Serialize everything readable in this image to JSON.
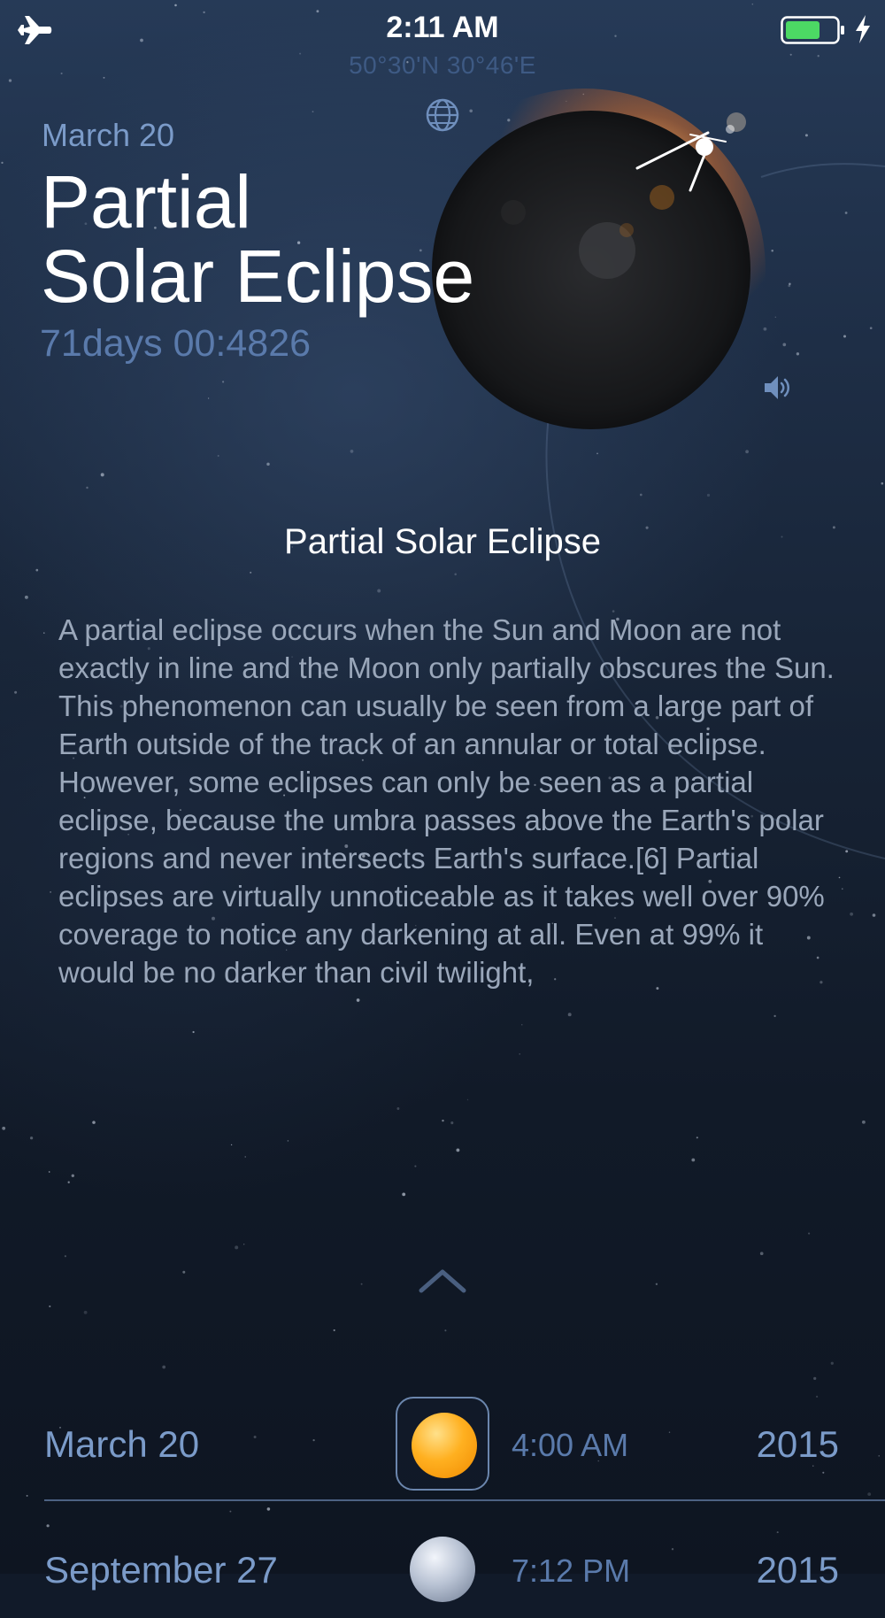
{
  "status_bar": {
    "time": "2:11 AM",
    "battery_color": "#4cd964"
  },
  "location": {
    "coordinates": "50°30'N 30°46'E"
  },
  "event": {
    "date": "March 20",
    "title_line1": "Partial",
    "title_line2": "Solar Eclipse",
    "countdown": "71days 00:4826"
  },
  "detail": {
    "heading": "Partial Solar Eclipse",
    "description": "A partial eclipse occurs when the Sun and Moon are not exactly in line and the Moon only partially obscures the Sun. This phenomenon can usually be seen from a large part of Earth outside of the track of an annular or total eclipse. However, some eclipses can only be seen as a partial eclipse, because the umbra passes above the Earth's polar regions and never intersects Earth's surface.[6] Partial eclipses are virtually unnoticeable as it takes well over 90% coverage to notice any darkening at all. Even at 99% it would be no darker than civil twilight,"
  },
  "icons": {
    "airplane": "airplane-icon",
    "battery": "battery-icon",
    "charging": "charging-bolt-icon",
    "globe": "globe-icon",
    "speaker": "speaker-icon",
    "chevron": "chevron-up-icon"
  },
  "events_list": [
    {
      "date": "March 20",
      "time": "4:00 AM",
      "year": "2015",
      "icon": "sun",
      "selected": true
    },
    {
      "date": "September 27",
      "time": "7:12 PM",
      "year": "2015",
      "icon": "moon",
      "selected": false
    }
  ],
  "colors": {
    "accent": "#7b9bc9",
    "muted_accent": "#5a7aab",
    "sun": "#ffa21a",
    "corona": "#ff8a2a"
  }
}
